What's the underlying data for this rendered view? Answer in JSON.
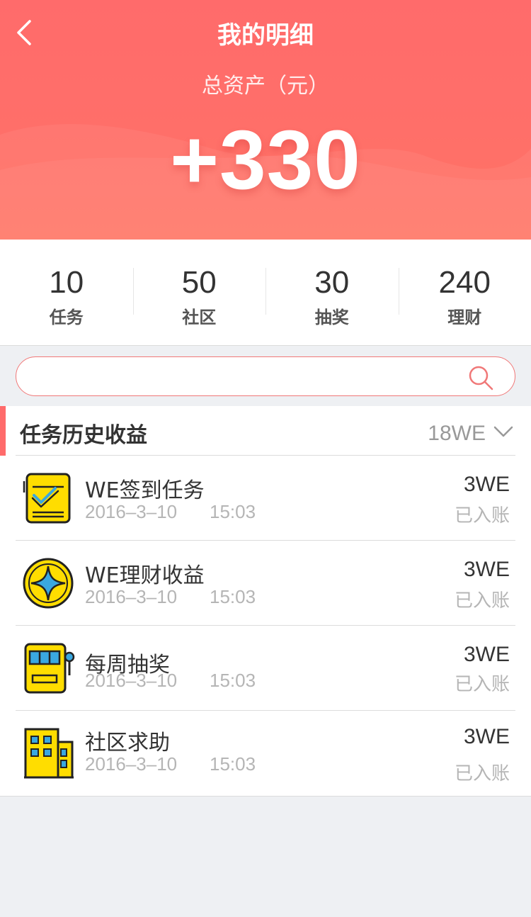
{
  "header": {
    "title": "我的明细",
    "subtitle": "总资产（元）",
    "total": "+330",
    "back_icon": "chevron-left-icon"
  },
  "stats": [
    {
      "value": "10",
      "label": "任务"
    },
    {
      "value": "50",
      "label": "社区"
    },
    {
      "value": "30",
      "label": "抽奖"
    },
    {
      "value": "240",
      "label": "理财"
    }
  ],
  "search": {
    "placeholder": "",
    "icon": "search-icon"
  },
  "section": {
    "title": "任务历史收益",
    "total": "18WE",
    "toggle_icon": "chevron-down-icon"
  },
  "records": [
    {
      "icon": "checklist-icon",
      "name": "WE签到任务",
      "date": "2016–3–10",
      "time": "15:03",
      "amount": "3WE",
      "status": "已入账"
    },
    {
      "icon": "star-coin-icon",
      "name": "WE理财收益",
      "date": "2016–3–10",
      "time": "15:03",
      "amount": "3WE",
      "status": "已入账"
    },
    {
      "icon": "slot-machine-icon",
      "name": "每周抽奖",
      "date": "2016–3–10",
      "time": "15:03",
      "amount": "3WE",
      "status": "已入账"
    },
    {
      "icon": "building-icon",
      "name": "社区求助",
      "date": "2016–3–10",
      "time": "15:03",
      "amount": "3WE",
      "status": "已入账"
    }
  ],
  "colors": {
    "accent": "#ff6b6b",
    "icon_yellow": "#ffdd00",
    "icon_blue": "#3aa8e0"
  }
}
